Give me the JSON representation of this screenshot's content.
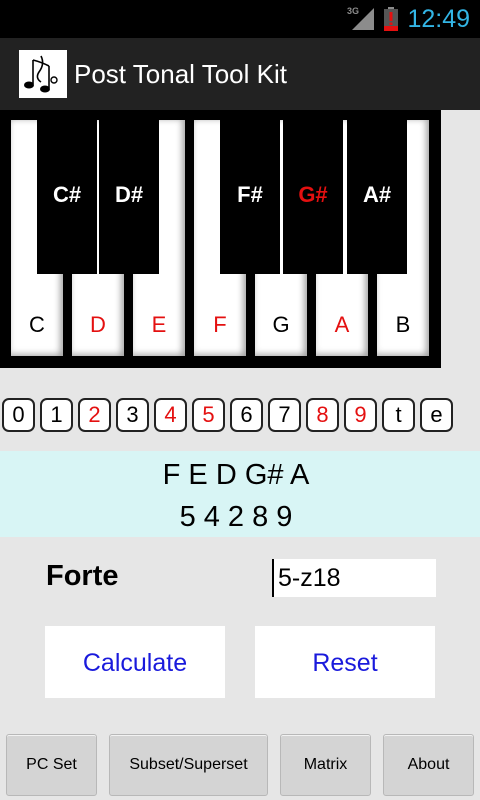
{
  "status_bar": {
    "network": "3G",
    "time": "12:49"
  },
  "app_bar": {
    "title": "Post Tonal Tool Kit"
  },
  "colors": {
    "active": "#e41010",
    "inactive": "#000000",
    "accent": "#33b5e5",
    "link_blue": "#1a1adc"
  },
  "keyboard": {
    "white_keys": [
      {
        "label": "C",
        "active": false
      },
      {
        "label": "D",
        "active": true
      },
      {
        "label": "E",
        "active": true
      },
      {
        "label": "F",
        "active": true
      },
      {
        "label": "G",
        "active": false
      },
      {
        "label": "A",
        "active": true
      },
      {
        "label": "B",
        "active": false
      }
    ],
    "black_keys": [
      {
        "label": "C#",
        "active": false
      },
      {
        "label": "D#",
        "active": false
      },
      {
        "label": "F#",
        "active": false
      },
      {
        "label": "G#",
        "active": true
      },
      {
        "label": "A#",
        "active": false
      }
    ]
  },
  "pitch_classes": [
    {
      "label": "0",
      "active": false
    },
    {
      "label": "1",
      "active": false
    },
    {
      "label": "2",
      "active": true
    },
    {
      "label": "3",
      "active": false
    },
    {
      "label": "4",
      "active": true
    },
    {
      "label": "5",
      "active": true
    },
    {
      "label": "6",
      "active": false
    },
    {
      "label": "7",
      "active": false
    },
    {
      "label": "8",
      "active": true
    },
    {
      "label": "9",
      "active": true
    },
    {
      "label": "t",
      "active": false
    },
    {
      "label": "e",
      "active": false
    }
  ],
  "pc_set": {
    "notes": "F E D G# A",
    "numbers": "5 4 2 8 9"
  },
  "forte": {
    "label": "Forte",
    "value": "5-z18"
  },
  "actions": {
    "calculate": "Calculate",
    "reset": "Reset"
  },
  "nav": {
    "pc_set": "PC Set",
    "subset_superset": "Subset/Superset",
    "matrix": "Matrix",
    "about": "About"
  }
}
